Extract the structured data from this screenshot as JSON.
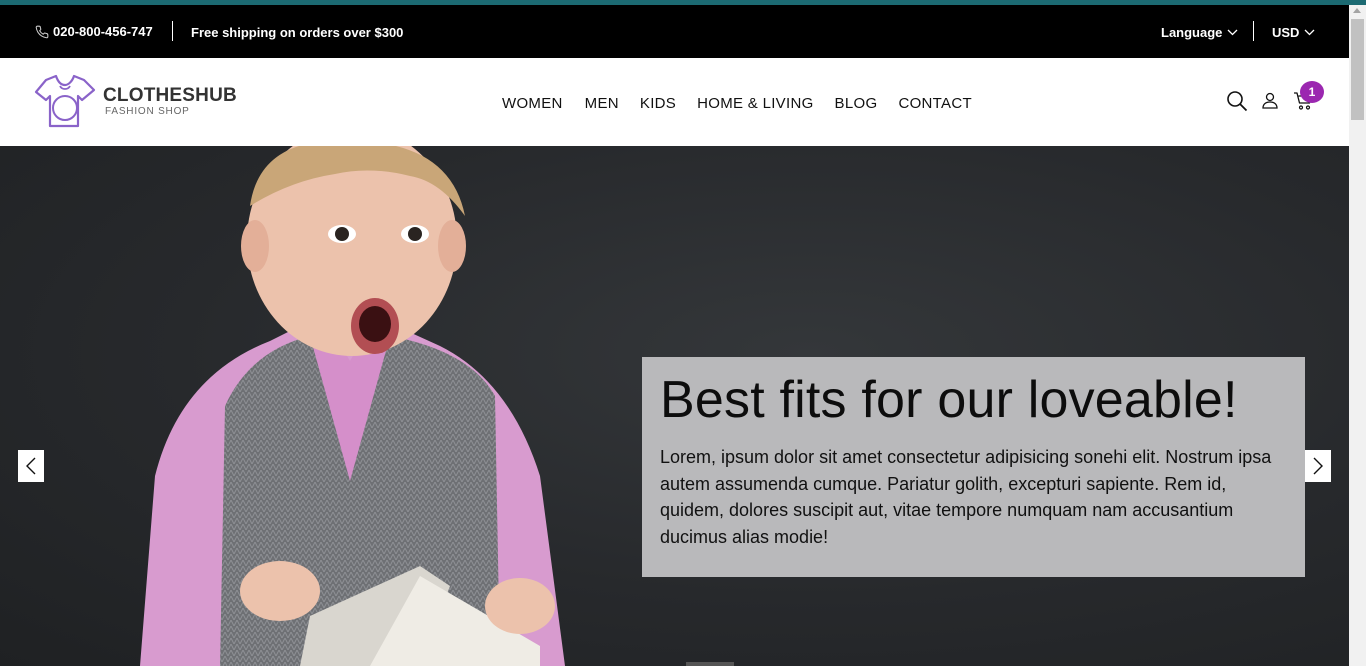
{
  "topbar": {
    "phone": "020-800-456-747",
    "shipping": "Free shipping on orders over $300",
    "language": "Language",
    "currency": "USD"
  },
  "header": {
    "logo_name": "CLOTHESHUB",
    "logo_sub": "FASHION SHOP",
    "menu": [
      "WOMEN",
      "MEN",
      "KIDS",
      "HOME & LIVING",
      "BLOG",
      "CONTACT"
    ],
    "cart_count": "1"
  },
  "hero": {
    "title": "Best fits for our loveable!",
    "text": "Lorem, ipsum dolor sit amet consectetur adipisicing sonehi elit. Nostrum ipsa autem assumenda cumque. Pariatur golith, excepturi sapiente. Rem id, quidem, dolores suscipit aut, vitae tempore numquam nam accusantium ducimus alias modie!"
  },
  "colors": {
    "accent_line": "#1c6a72",
    "badge": "#9b27b0",
    "logo": "#8a63c9"
  },
  "icons": [
    "phone-icon",
    "chevron-down-icon",
    "search-icon",
    "user-icon",
    "cart-icon",
    "chevron-left-icon",
    "chevron-right-icon"
  ]
}
